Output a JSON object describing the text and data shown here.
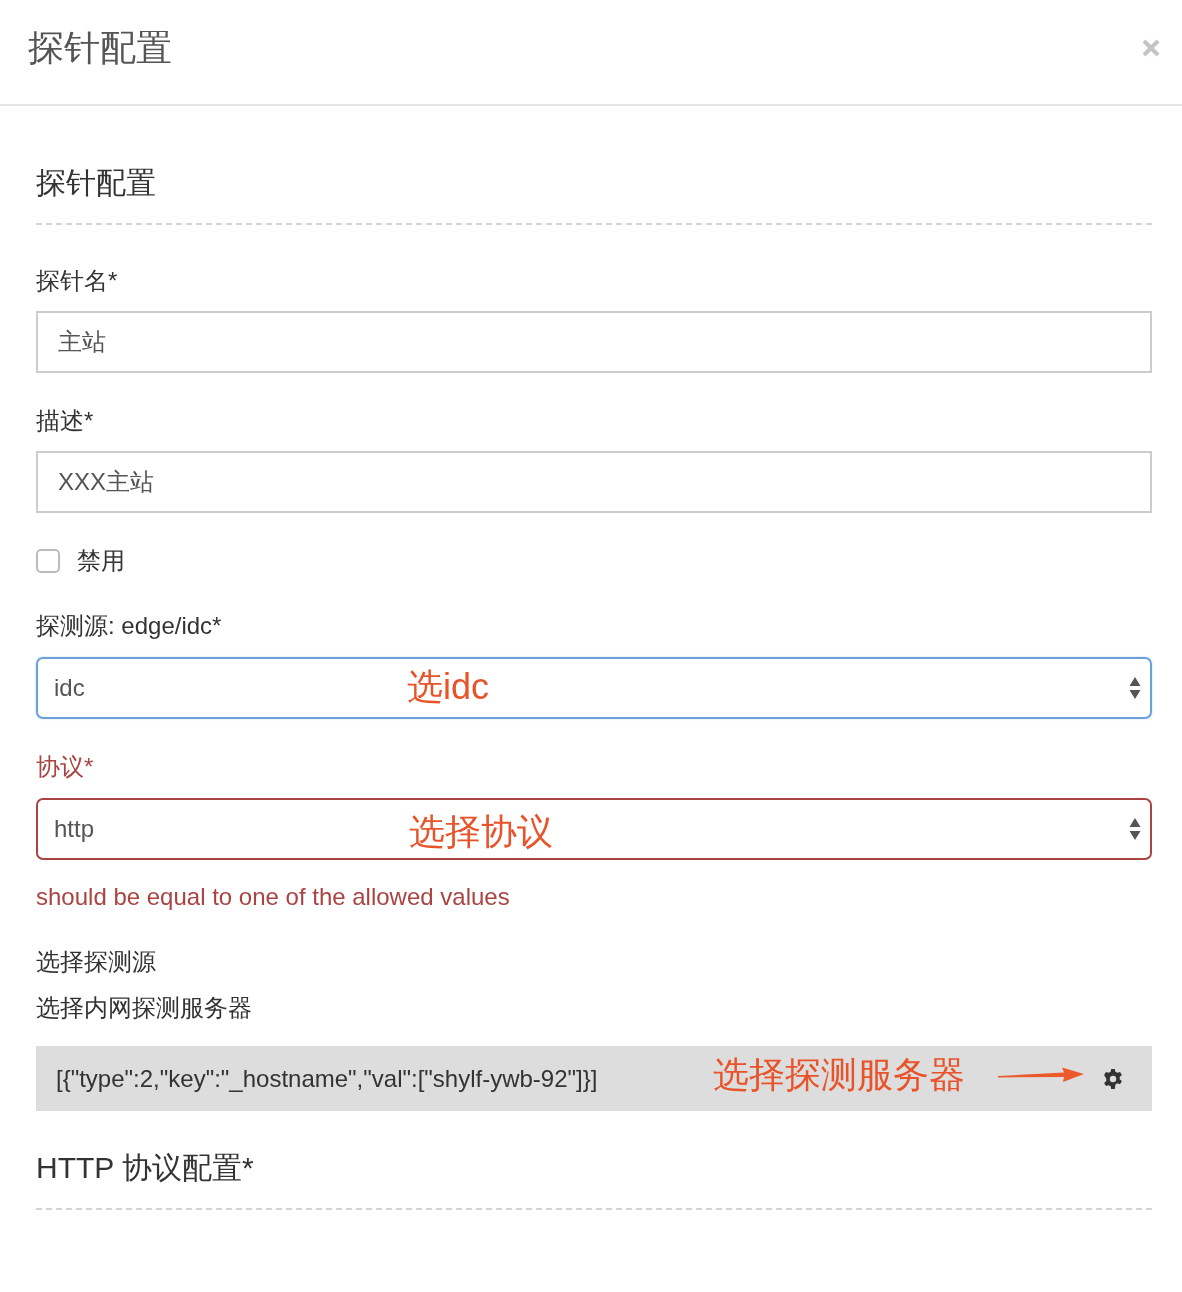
{
  "dialog": {
    "title": "探针配置"
  },
  "section": {
    "title": "探针配置"
  },
  "fields": [
    {
      "kind": "text",
      "label": "探针名*",
      "value": "主站"
    },
    {
      "kind": "text",
      "label": "描述*",
      "value": "XXX主站"
    },
    {
      "kind": "checkbox",
      "label": "禁用",
      "checked": false
    },
    {
      "kind": "select",
      "label": "探测源: edge/idc*",
      "value": "idc",
      "focused": true,
      "invalid": false,
      "annotation": "选idc"
    },
    {
      "kind": "select",
      "label": "协议*",
      "value": "http",
      "focused": false,
      "invalid": true,
      "error": "should be equal to one of the allowed values",
      "annotation": "选择协议"
    },
    {
      "kind": "picker",
      "label": "选择探测源",
      "hint": "选择内网探测服务器",
      "value": "[{\"type\":2,\"key\":\"_hostname\",\"val\":[\"shylf-ywb-92\"]}]",
      "annotation": "选择探测服务器"
    }
  ],
  "subsection": {
    "title": "HTTP 协议配置*"
  }
}
